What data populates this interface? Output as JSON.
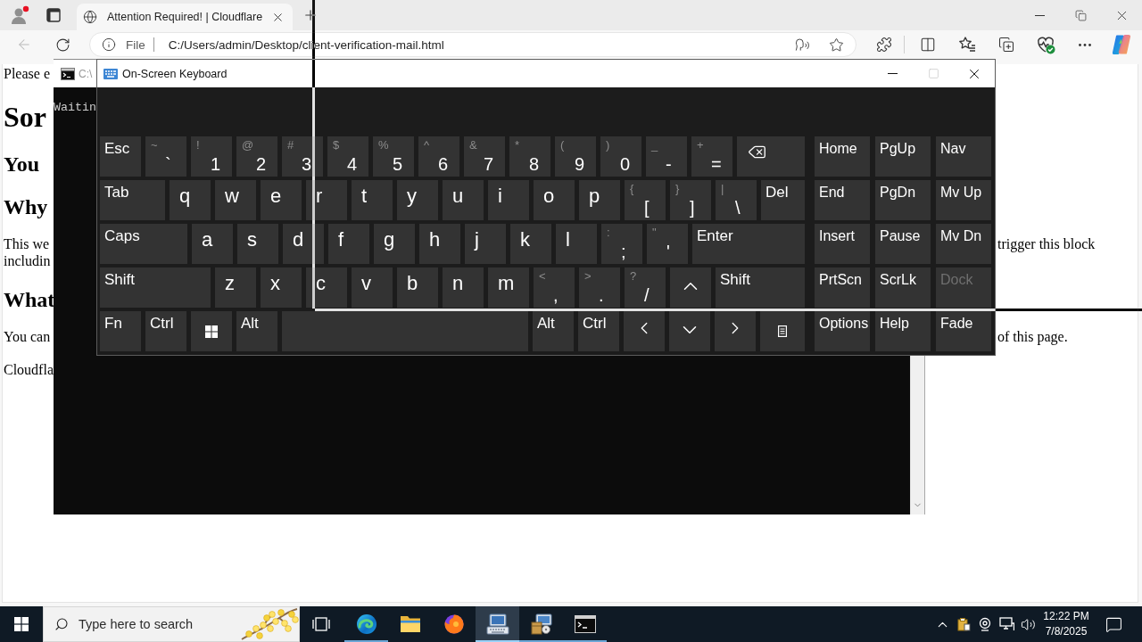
{
  "browser": {
    "tabs": [
      {
        "title": "Attention Required! | Cloudflare",
        "selected": true
      }
    ],
    "back_button": {
      "disabled": true
    },
    "address_bar": {
      "scheme": "File",
      "url": "C:/Users/admin/Desktop/client-verification-mail.html"
    }
  },
  "page": {
    "blocks": [
      {
        "kind": "paragraph",
        "left": [
          "Please e"
        ]
      },
      {
        "kind": "title",
        "left": [
          "Sor"
        ]
      },
      {
        "kind": "heading",
        "left": [
          "You"
        ]
      },
      {
        "kind": "heading",
        "left": [
          "Why"
        ]
      },
      {
        "kind": "paragraph",
        "left": [
          "This we",
          "includin"
        ],
        "right": [
          "trigger this block"
        ]
      },
      {
        "kind": "heading",
        "left": [
          "What"
        ]
      },
      {
        "kind": "paragraph",
        "left": [
          "You can"
        ],
        "right": [
          "of this page."
        ]
      },
      {
        "kind": "paragraph",
        "left": [
          "Cloudfla"
        ]
      }
    ]
  },
  "console_window": {
    "title": "C:\\",
    "output": "Waitin"
  },
  "keyboard_window": {
    "title": "On-Screen Keyboard",
    "window_buttons": [
      {
        "kind": "minimize",
        "disabled": false
      },
      {
        "kind": "maximize",
        "disabled": true
      },
      {
        "kind": "close",
        "disabled": false
      }
    ],
    "main_rows": [
      [
        {
          "kind": "label",
          "label": "Esc"
        },
        {
          "kind": "symbol",
          "shift": "~",
          "base": "`"
        },
        {
          "kind": "symbol",
          "shift": "!",
          "base": "1"
        },
        {
          "kind": "symbol",
          "shift": "@",
          "base": "2"
        },
        {
          "kind": "symbol",
          "shift": "#",
          "base": "3"
        },
        {
          "kind": "symbol",
          "shift": "$",
          "base": "4"
        },
        {
          "kind": "symbol",
          "shift": "%",
          "base": "5"
        },
        {
          "kind": "symbol",
          "shift": "^",
          "base": "6"
        },
        {
          "kind": "symbol",
          "shift": "&",
          "base": "7"
        },
        {
          "kind": "symbol",
          "shift": "*",
          "base": "8"
        },
        {
          "kind": "symbol",
          "shift": "(",
          "base": "9"
        },
        {
          "kind": "symbol",
          "shift": ")",
          "base": "0"
        },
        {
          "kind": "symbol",
          "shift": "_",
          "base": "-"
        },
        {
          "kind": "symbol",
          "shift": "+",
          "base": "="
        },
        {
          "kind": "backspace"
        }
      ],
      [
        {
          "kind": "label",
          "label": "Tab"
        },
        {
          "kind": "letter",
          "label": "q"
        },
        {
          "kind": "letter",
          "label": "w"
        },
        {
          "kind": "letter",
          "label": "e"
        },
        {
          "kind": "letter",
          "label": "r"
        },
        {
          "kind": "letter",
          "label": "t"
        },
        {
          "kind": "letter",
          "label": "y"
        },
        {
          "kind": "letter",
          "label": "u"
        },
        {
          "kind": "letter",
          "label": "i"
        },
        {
          "kind": "letter",
          "label": "o"
        },
        {
          "kind": "letter",
          "label": "p"
        },
        {
          "kind": "symbol",
          "shift": "{",
          "base": "["
        },
        {
          "kind": "symbol",
          "shift": "}",
          "base": "]"
        },
        {
          "kind": "symbol",
          "shift": "|",
          "base": "\\"
        },
        {
          "kind": "label",
          "label": "Del"
        }
      ],
      [
        {
          "kind": "label",
          "label": "Caps"
        },
        {
          "kind": "letter",
          "label": "a"
        },
        {
          "kind": "letter",
          "label": "s"
        },
        {
          "kind": "letter",
          "label": "d"
        },
        {
          "kind": "letter",
          "label": "f"
        },
        {
          "kind": "letter",
          "label": "g"
        },
        {
          "kind": "letter",
          "label": "h"
        },
        {
          "kind": "letter",
          "label": "j"
        },
        {
          "kind": "letter",
          "label": "k"
        },
        {
          "kind": "letter",
          "label": "l"
        },
        {
          "kind": "symbol",
          "shift": ":",
          "base": ";"
        },
        {
          "kind": "symbol",
          "shift": "\"",
          "base": "'"
        },
        {
          "kind": "label",
          "label": "Enter"
        }
      ],
      [
        {
          "kind": "label",
          "label": "Shift"
        },
        {
          "kind": "letter",
          "label": "z"
        },
        {
          "kind": "letter",
          "label": "x"
        },
        {
          "kind": "letter",
          "label": "c"
        },
        {
          "kind": "letter",
          "label": "v"
        },
        {
          "kind": "letter",
          "label": "b"
        },
        {
          "kind": "letter",
          "label": "n"
        },
        {
          "kind": "letter",
          "label": "m"
        },
        {
          "kind": "symbol",
          "shift": "<",
          "base": ","
        },
        {
          "kind": "symbol",
          "shift": ">",
          "base": "."
        },
        {
          "kind": "symbol",
          "shift": "?",
          "base": "/"
        },
        {
          "kind": "up"
        },
        {
          "kind": "label",
          "label": "Shift"
        }
      ],
      [
        {
          "kind": "label",
          "label": "Fn"
        },
        {
          "kind": "label",
          "label": "Ctrl"
        },
        {
          "kind": "windows"
        },
        {
          "kind": "label",
          "label": "Alt"
        },
        {
          "kind": "space"
        },
        {
          "kind": "label",
          "label": "Alt"
        },
        {
          "kind": "label",
          "label": "Ctrl"
        },
        {
          "kind": "left"
        },
        {
          "kind": "down"
        },
        {
          "kind": "right"
        },
        {
          "kind": "menu"
        }
      ]
    ],
    "nav_rows": [
      [
        {
          "label": "Home",
          "disabled": false
        },
        {
          "label": "PgUp",
          "disabled": false
        },
        {
          "label": "Nav",
          "disabled": false
        }
      ],
      [
        {
          "label": "End",
          "disabled": false
        },
        {
          "label": "PgDn",
          "disabled": false
        },
        {
          "label": "Mv Up",
          "disabled": false
        }
      ],
      [
        {
          "label": "Insert",
          "disabled": false
        },
        {
          "label": "Pause",
          "disabled": false
        },
        {
          "label": "Mv Dn",
          "disabled": false
        }
      ],
      [
        {
          "label": "PrtScn",
          "disabled": false
        },
        {
          "label": "ScrLk",
          "disabled": false
        },
        {
          "label": "Dock",
          "disabled": true
        }
      ],
      [
        {
          "label": "Options",
          "disabled": false
        },
        {
          "label": "Help",
          "disabled": false
        },
        {
          "label": "Fade",
          "disabled": false
        }
      ]
    ]
  },
  "taskbar": {
    "search": {
      "placeholder": "Type here to search"
    },
    "apps": [
      {
        "kind": "wave",
        "running": true,
        "selected": false
      },
      {
        "kind": "folder",
        "running": false,
        "selected": false
      },
      {
        "kind": "fox",
        "running": false,
        "selected": false
      },
      {
        "kind": "keyboard",
        "running": true,
        "selected": true
      },
      {
        "kind": "setup",
        "running": true,
        "selected": false
      },
      {
        "kind": "console",
        "running": true,
        "selected": false
      }
    ],
    "clock": {
      "time": "12:22 PM",
      "date": "7/8/2025"
    }
  }
}
